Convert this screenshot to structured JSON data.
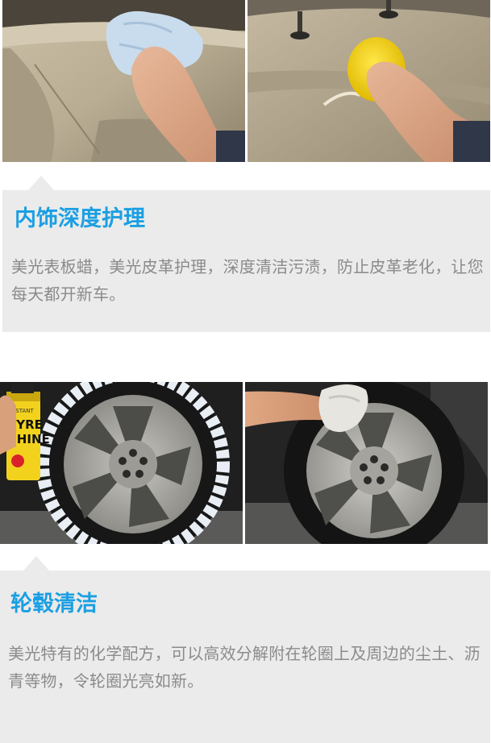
{
  "sections": [
    {
      "title": "内饰深度护理",
      "body": "美光表板蜡，美光皮革护理，深度清洁污渍，防止皮革老化，让您每天都开新车。"
    },
    {
      "title": "轮毂清洁",
      "body": "美光特有的化学配方，可以高效分解附在轮圈上及周边的尘土、沥青等物，令轮圈光亮如新。"
    }
  ],
  "product_can": {
    "label_top": "INSTANT",
    "label_main_1": "TYRE",
    "label_main_2": "SHINE"
  },
  "colors": {
    "accent_blue": "#1a9fe3",
    "panel_bg": "#ebebeb",
    "body_text": "#8b8b8b"
  }
}
